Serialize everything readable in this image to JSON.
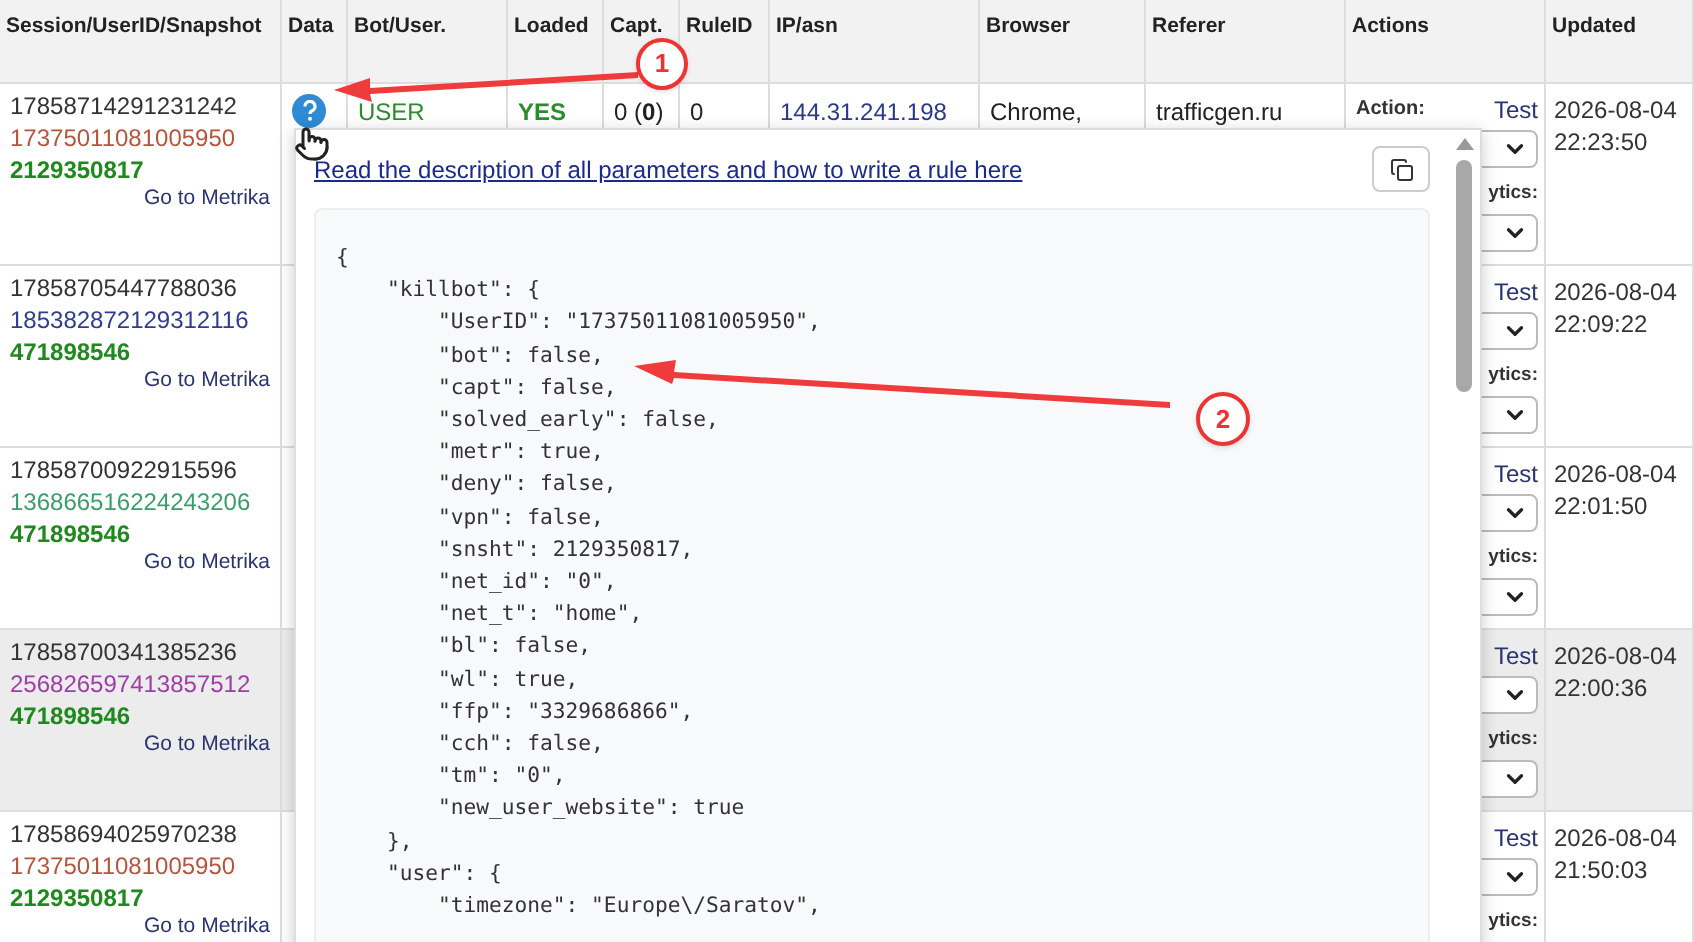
{
  "table": {
    "columns": [
      "Session/UserID/Snapshot",
      "Data",
      "Bot/User.",
      "Loaded",
      "Capt.",
      "RuleID",
      "IP/asn",
      "Browser",
      "Referer",
      "Actions",
      "Updated"
    ],
    "rows": [
      {
        "shaded": false,
        "session": "17858714291231242",
        "user_id": "17375011081005950",
        "color": "#b5553c",
        "snapshot": "2129350817",
        "metrika_link": "Go to Metrika",
        "bot_user": "USER",
        "loaded": "YES",
        "capt": "0 (**0**)",
        "rule_id": "0",
        "ip": "144.31.241.198",
        "browser": "Chrome,",
        "referer": "trafficgen.ru",
        "action_label": "Action:",
        "test_link": "Test",
        "analytics_label": "ytics:",
        "updated": "2026-08-04 22:23:50"
      },
      {
        "shaded": false,
        "session": "17858705447788036",
        "user_id": "185382872129312116",
        "color": "#2e3d8f",
        "snapshot": "471898546",
        "metrika_link": "Go to Metrika",
        "test_link": "Test",
        "analytics_label": "ytics:",
        "updated": "2026-08-04 22:09:22"
      },
      {
        "shaded": false,
        "session": "17858700922915596",
        "user_id": "136866516224243206",
        "color": "#3a9e6a",
        "snapshot": "471898546",
        "metrika_link": "Go to Metrika",
        "test_link": "Test",
        "analytics_label": "ytics:",
        "updated": "2026-08-04 22:01:50"
      },
      {
        "shaded": true,
        "session": "17858700341385236",
        "user_id": "256826597413857512",
        "color": "#a03ca6",
        "snapshot": "471898546",
        "metrika_link": "Go to Metrika",
        "test_link": "Test",
        "analytics_label": "ytics:",
        "updated": "2026-08-04 22:00:36"
      },
      {
        "shaded": false,
        "session": "17858694025970238",
        "user_id": "17375011081005950",
        "color": "#b5553c",
        "snapshot": "2129350817",
        "metrika_link": "Go to Metrika",
        "test_link": "Test",
        "analytics_label": "ytics:",
        "updated": "2026-08-04 21:50:03"
      }
    ]
  },
  "popup": {
    "help_link": "Read the description of all parameters and how to write a rule here",
    "code_lines": [
      "{",
      "    \"killbot\": {",
      "        \"UserID\": \"17375011081005950\",",
      "        \"bot\": false,",
      "        \"capt\": false,",
      "        \"solved_early\": false,",
      "        \"metr\": true,",
      "        \"deny\": false,",
      "        \"vpn\": false,",
      "        \"snsht\": 2129350817,",
      "        \"net_id\": \"0\",",
      "        \"net_t\": \"home\",",
      "        \"bl\": false,",
      "        \"wl\": true,",
      "        \"ffp\": \"3329686866\",",
      "        \"cch\": false,",
      "        \"tm\": \"0\",",
      "        \"new_user_website\": true",
      "    },",
      "    \"user\": {",
      "        \"timezone\": \"Europe\\/Saratov\","
    ]
  },
  "annotations": [
    {
      "label": "1"
    },
    {
      "label": "2"
    }
  ]
}
